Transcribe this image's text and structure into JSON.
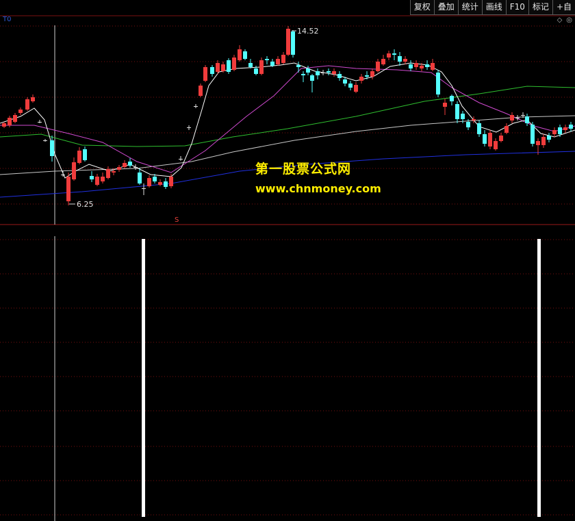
{
  "toolbar": {
    "items": [
      "复权",
      "叠加",
      "统计",
      "画线",
      "F10",
      "标记",
      "+自"
    ]
  },
  "pane_label": "T0",
  "pane_icons": {
    "diamond": "◇",
    "circle": "◎"
  },
  "price_labels": {
    "high": "14.52",
    "low": "6.25"
  },
  "marker": "S",
  "watermark": {
    "line1": "第一股票公式网",
    "line2": "www.chnmoney.com"
  },
  "colors": {
    "background": "#000000",
    "up_candle": "#f03c3c",
    "down_candle": "#54ffff",
    "ma_white": "#ffffff",
    "ma_magenta": "#d04ad0",
    "ma_green": "#2fbf2f",
    "ma_gray": "#c8c8c8",
    "ma_blue": "#2030e0",
    "grid": "#7a1010",
    "watermark": "#ffee00"
  }
}
